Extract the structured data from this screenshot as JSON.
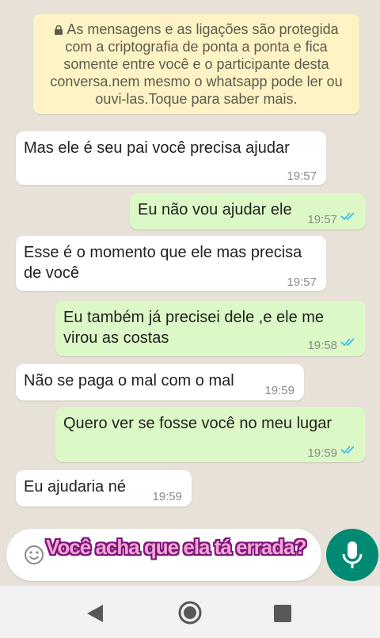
{
  "encryption_notice": "As mensagens e as ligações são protegida com a criptografia de ponta a ponta e fica somente entre você e o participante desta conversa.nem mesmo o whatsapp pode ler ou ouvi-las.Toque para saber mais.",
  "messages": [
    {
      "direction": "in",
      "text": "Mas ele é seu pai você precisa ajudar",
      "time": "19:57"
    },
    {
      "direction": "out",
      "text": "Eu não vou ajudar ele",
      "time": "19:57",
      "read": true
    },
    {
      "direction": "in",
      "text": "Esse é o momento que ele mas precisa\nde você",
      "time": "19:57"
    },
    {
      "direction": "out",
      "text": "Eu também já precisei dele ,e ele me\nvirou as costas",
      "time": "19:58",
      "read": true
    },
    {
      "direction": "in",
      "text": "Não se paga o mal com o mal",
      "time": "19:59"
    },
    {
      "direction": "out",
      "text": "Quero ver se fosse você no meu lugar",
      "time": "19:59",
      "read": true
    },
    {
      "direction": "in",
      "text": "Eu ajudaria né",
      "time": "19:59"
    }
  ],
  "overlay_caption": "Você acha que ela tá errada?",
  "icons": {
    "notice": "lock-icon",
    "read_receipt": "double-check-icon",
    "input_left": "emoji-icon",
    "send": "microphone-icon",
    "nav": [
      "back-icon",
      "home-icon",
      "recent-apps-icon"
    ]
  },
  "colors": {
    "incoming_bubble": "#ffffff",
    "outgoing_bubble": "#dcf8c6",
    "notice_background": "#fdf3c4",
    "read_ticks": "#34b7f1",
    "mic_button": "#008a73",
    "caption_fill": "#f5a4d8",
    "caption_outline": "#7a1678"
  }
}
